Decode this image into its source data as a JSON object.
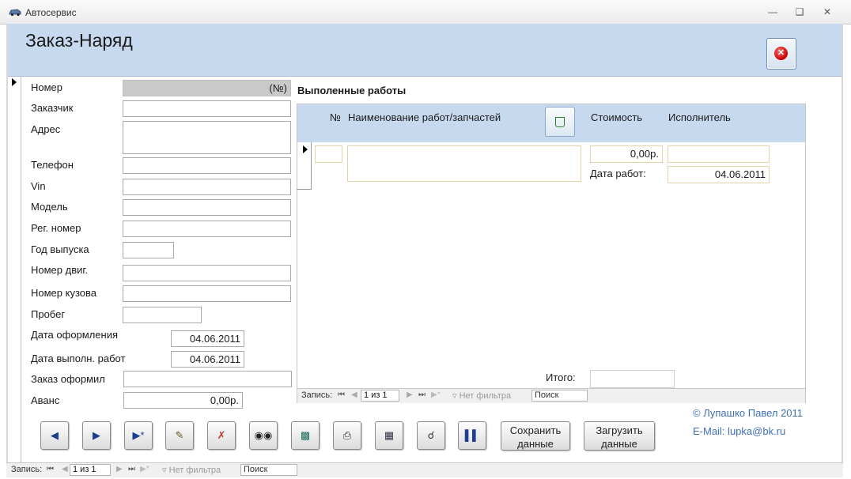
{
  "window": {
    "title": "Автосервис"
  },
  "form": {
    "title": "Заказ-Наряд",
    "fields": [
      {
        "label": "Номер",
        "value": "(№)"
      },
      {
        "label": "Заказчик",
        "value": ""
      },
      {
        "label": "Адрес",
        "value": ""
      },
      {
        "label": "Телефон",
        "value": ""
      },
      {
        "label": "Vin",
        "value": ""
      },
      {
        "label": "Модель",
        "value": ""
      },
      {
        "label": "Рег. номер",
        "value": ""
      },
      {
        "label": "Год выпуска",
        "value": ""
      },
      {
        "label": "Номер двиг.",
        "value": ""
      },
      {
        "label": "Номер кузова",
        "value": ""
      },
      {
        "label": "Пробег",
        "value": ""
      },
      {
        "label": "Дата оформления",
        "value": "04.06.2011"
      },
      {
        "label": "Дата выполн. работ",
        "value": "04.06.2011"
      },
      {
        "label": "Заказ оформил",
        "value": ""
      },
      {
        "label": "Аванс",
        "value": "0,00р."
      }
    ]
  },
  "works": {
    "title": "Выполенные работы",
    "columns": {
      "num": "№",
      "name": "Наименование работ/запчастей",
      "cost": "Стоимость",
      "executor": "Исполнитель"
    },
    "row": {
      "num": "",
      "name": "",
      "cost": "0,00р.",
      "executor": "",
      "date_label": "Дата работ:",
      "date": "04.06.2011"
    },
    "total_label": "Итого:",
    "total_value": ""
  },
  "sub_nav": {
    "label": "Запись:",
    "position": "1 из 1",
    "filter": "Нет фильтра",
    "search": "Поиск"
  },
  "main_nav": {
    "label": "Запись:",
    "position": "1 из 1",
    "filter": "Нет фильтра",
    "search": "Поиск"
  },
  "toolbar": {
    "save_label": "Сохранить данные",
    "load_label": "Загрузить данные",
    "icons": [
      "prev-record-icon",
      "next-record-icon",
      "new-record-icon",
      "edit-icon",
      "delete-icon",
      "find-icon",
      "book-icon",
      "print-icon",
      "calculator-icon",
      "preview-icon",
      "report-icon"
    ]
  },
  "footer": {
    "copyright": "© Лупашко Павел 2011",
    "email": "E-Mail: lupka@bk.ru"
  },
  "colors": {
    "header": "#c7d9ef",
    "link": "#3d6fb4"
  }
}
